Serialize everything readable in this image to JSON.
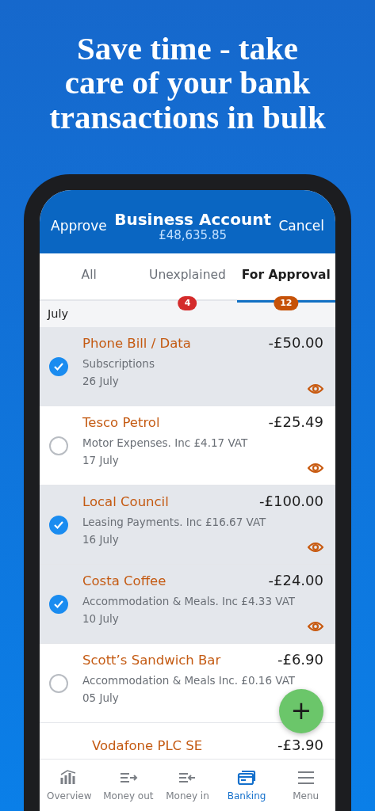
{
  "headline": [
    "Save time - take",
    "care of your bank",
    "transactions in bulk"
  ],
  "header": {
    "left_action": "Approve",
    "title": "Business Account",
    "balance": "£48,635.85",
    "right_action": "Cancel"
  },
  "tabs": [
    {
      "label": "All",
      "selected": false
    },
    {
      "label": "Unexplained",
      "selected": false,
      "badge": "4",
      "color": "#d42b2b"
    },
    {
      "label": "For Approval",
      "selected": true,
      "badge": "12",
      "color": "#c65208"
    }
  ],
  "section": "July",
  "transactions": [
    {
      "kind": "full",
      "title": "Phone Bill / Data",
      "amount": "-£50.00",
      "category": "Subscriptions",
      "date": "26 July",
      "checked": true,
      "preview_icon": true
    },
    {
      "kind": "full",
      "title": "Tesco Petrol",
      "amount": "-£25.49",
      "category": "Motor Expenses. Inc £4.17 VAT",
      "date": "17 July",
      "checked": false,
      "preview_icon": true
    },
    {
      "kind": "full",
      "title": "Local Council",
      "amount": "-£100.00",
      "category": "Leasing Payments. Inc £16.67 VAT",
      "date": "16 July",
      "checked": true,
      "preview_icon": true
    },
    {
      "kind": "full",
      "title": "Costa Coffee",
      "amount": "-£24.00",
      "category": "Accommodation & Meals. Inc £4.33 VAT",
      "date": "10 July",
      "checked": true,
      "preview_icon": true
    },
    {
      "kind": "full",
      "title": "Scott’s Sandwich Bar",
      "amount": "-£6.90",
      "category": "Accommodation & Meals Inc. £0.16 VAT",
      "date": "05 July",
      "checked": false,
      "preview_icon": false
    },
    {
      "kind": "cut",
      "title": "Vodafone PLC SE",
      "amount": "-£3.90"
    }
  ],
  "fab": "+",
  "nav": [
    {
      "label": "Overview",
      "selected": false
    },
    {
      "label": "Money out",
      "selected": false
    },
    {
      "label": "Money in",
      "selected": false
    },
    {
      "label": "Banking",
      "selected": true
    },
    {
      "label": "Menu",
      "selected": false
    }
  ]
}
